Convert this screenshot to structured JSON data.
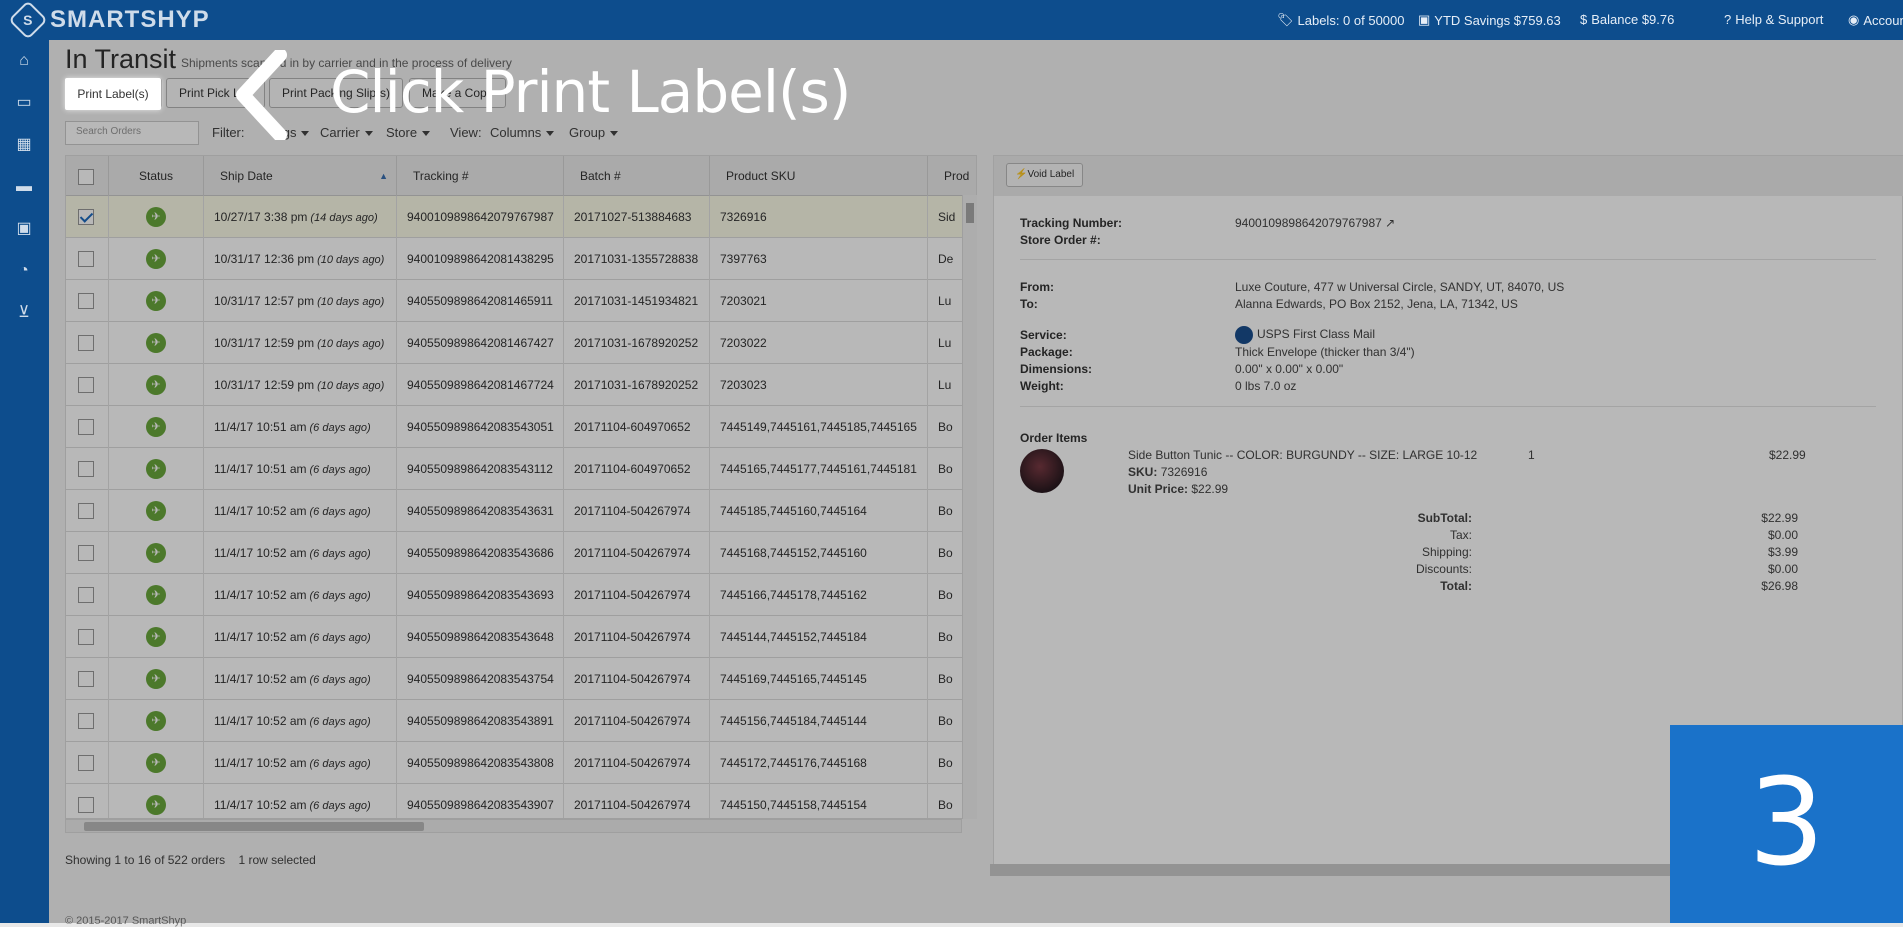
{
  "brand": {
    "name": "SMARTSHYP",
    "colors": {
      "primary": "#0d4d8d",
      "accent": "#1a72c9",
      "status_green": "#6aa83c"
    }
  },
  "topnav": {
    "labels": "Labels: 0 of 50000",
    "ytd": "YTD Savings $759.63",
    "balance": "Balance $9.76",
    "help": "Help & Support",
    "account": "Accoun"
  },
  "sidebar": {
    "icons": [
      "home-icon",
      "basket-icon",
      "calendar-icon",
      "truck-icon",
      "contacts-icon",
      "pie-chart-icon",
      "cart-icon"
    ]
  },
  "page": {
    "title": "In Transit",
    "subtitle": "Shipments scanned in by carrier and in the process of delivery"
  },
  "toolbar": {
    "print_labels": "Print Label(s)",
    "print_picklist": "Print Pick List",
    "print_packing": "Print Packing Slip(s)",
    "make_copy": "Make a Copy"
  },
  "filters": {
    "search_placeholder": "Search Orders",
    "filter_label": "Filter:",
    "tags": "Tags",
    "carrier": "Carrier",
    "store": "Store",
    "view_label": "View:",
    "columns": "Columns",
    "group": "Group"
  },
  "table": {
    "columns": [
      "Status",
      "Ship Date",
      "Tracking #",
      "Batch #",
      "Product SKU",
      "Prod"
    ],
    "rows": [
      {
        "selected": true,
        "date": "10/27/17 3:38 pm",
        "ago": "(14 days ago)",
        "tracking": "9400109898642079767987",
        "batch": "20171027-513884683",
        "sku": "7326916",
        "prod": "Sid"
      },
      {
        "selected": false,
        "date": "10/31/17 12:36 pm",
        "ago": "(10 days ago)",
        "tracking": "9400109898642081438295",
        "batch": "20171031-1355728838",
        "sku": "7397763",
        "prod": "De"
      },
      {
        "selected": false,
        "date": "10/31/17 12:57 pm",
        "ago": "(10 days ago)",
        "tracking": "9405509898642081465911",
        "batch": "20171031-1451934821",
        "sku": "7203021",
        "prod": "Lu"
      },
      {
        "selected": false,
        "date": "10/31/17 12:59 pm",
        "ago": "(10 days ago)",
        "tracking": "9405509898642081467427",
        "batch": "20171031-1678920252",
        "sku": "7203022",
        "prod": "Lu"
      },
      {
        "selected": false,
        "date": "10/31/17 12:59 pm",
        "ago": "(10 days ago)",
        "tracking": "9405509898642081467724",
        "batch": "20171031-1678920252",
        "sku": "7203023",
        "prod": "Lu"
      },
      {
        "selected": false,
        "date": "11/4/17 10:51 am",
        "ago": "(6 days ago)",
        "tracking": "9405509898642083543051",
        "batch": "20171104-604970652",
        "sku": "7445149,7445161,7445185,7445165",
        "prod": "Bo"
      },
      {
        "selected": false,
        "date": "11/4/17 10:51 am",
        "ago": "(6 days ago)",
        "tracking": "9405509898642083543112",
        "batch": "20171104-604970652",
        "sku": "7445165,7445177,7445161,7445181",
        "prod": "Bo"
      },
      {
        "selected": false,
        "date": "11/4/17 10:52 am",
        "ago": "(6 days ago)",
        "tracking": "9405509898642083543631",
        "batch": "20171104-504267974",
        "sku": "7445185,7445160,7445164",
        "prod": "Bo"
      },
      {
        "selected": false,
        "date": "11/4/17 10:52 am",
        "ago": "(6 days ago)",
        "tracking": "9405509898642083543686",
        "batch": "20171104-504267974",
        "sku": "7445168,7445152,7445160",
        "prod": "Bo"
      },
      {
        "selected": false,
        "date": "11/4/17 10:52 am",
        "ago": "(6 days ago)",
        "tracking": "9405509898642083543693",
        "batch": "20171104-504267974",
        "sku": "7445166,7445178,7445162",
        "prod": "Bo"
      },
      {
        "selected": false,
        "date": "11/4/17 10:52 am",
        "ago": "(6 days ago)",
        "tracking": "9405509898642083543648",
        "batch": "20171104-504267974",
        "sku": "7445144,7445152,7445184",
        "prod": "Bo"
      },
      {
        "selected": false,
        "date": "11/4/17 10:52 am",
        "ago": "(6 days ago)",
        "tracking": "9405509898642083543754",
        "batch": "20171104-504267974",
        "sku": "7445169,7445165,7445145",
        "prod": "Bo"
      },
      {
        "selected": false,
        "date": "11/4/17 10:52 am",
        "ago": "(6 days ago)",
        "tracking": "9405509898642083543891",
        "batch": "20171104-504267974",
        "sku": "7445156,7445184,7445144",
        "prod": "Bo"
      },
      {
        "selected": false,
        "date": "11/4/17 10:52 am",
        "ago": "(6 days ago)",
        "tracking": "9405509898642083543808",
        "batch": "20171104-504267974",
        "sku": "7445172,7445176,7445168",
        "prod": "Bo"
      },
      {
        "selected": false,
        "date": "11/4/17 10:52 am",
        "ago": "(6 days ago)",
        "tracking": "9405509898642083543907",
        "batch": "20171104-504267974",
        "sku": "7445150,7445158,7445154",
        "prod": "Bo"
      }
    ]
  },
  "footer": {
    "showing": "Showing 1 to 16 of 522 orders",
    "selected": "1 row selected",
    "copyright": "© 2015-2017 SmartShyp"
  },
  "detail": {
    "void_label": "Void Label",
    "tracking_label": "Tracking Number:",
    "tracking_value": "9400109898642079767987",
    "store_order_label": "Store Order #:",
    "from_label": "From:",
    "from_value": "Luxe Couture, 477 w Universal Circle, SANDY, UT, 84070, US",
    "to_label": "To:",
    "to_value": "Alanna Edwards, PO Box 2152, Jena, LA, 71342, US",
    "service_label": "Service:",
    "service_value": "USPS First Class Mail",
    "package_label": "Package:",
    "package_value": "Thick Envelope (thicker than 3/4\")",
    "dimensions_label": "Dimensions:",
    "dimensions_value": "0.00\" x 0.00\" x 0.00\"",
    "weight_label": "Weight:",
    "weight_value": "0 lbs 7.0 oz",
    "order_items_label": "Order Items",
    "item_name": "Side Button Tunic -- COLOR: BURGUNDY -- SIZE: LARGE 10-12",
    "item_qty": "1",
    "item_price": "$22.99",
    "sku_label": "SKU:",
    "sku_value": "7326916",
    "unit_price_label": "Unit Price:",
    "unit_price_value": "$22.99",
    "subtotal_label": "SubTotal:",
    "subtotal_value": "$22.99",
    "tax_label": "Tax:",
    "tax_value": "$0.00",
    "shipping_label": "Shipping:",
    "shipping_value": "$3.99",
    "discounts_label": "Discounts:",
    "discounts_value": "$0.00",
    "total_label": "Total:",
    "total_value": "$26.98"
  },
  "tutorial": {
    "callout": "Click Print Label(s)",
    "step": "3"
  }
}
